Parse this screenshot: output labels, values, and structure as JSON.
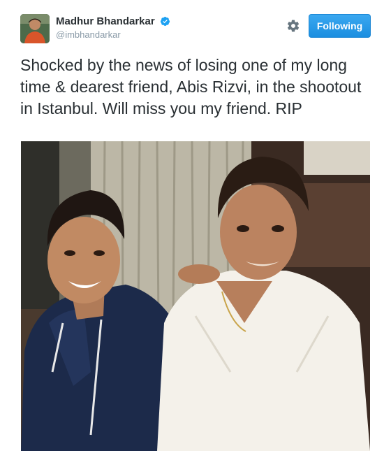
{
  "user": {
    "display_name": "Madhur Bhandarkar",
    "handle": "@imbhandarkar",
    "verified_icon": "verified-badge-icon"
  },
  "actions": {
    "settings_icon": "gear-icon",
    "follow_label": "Following"
  },
  "tweet": {
    "text": "Shocked by the news of losing one of my long time & dearest friend, Abis Rizvi, in the shootout in Istanbul. Will miss you my friend. RIP"
  },
  "colors": {
    "follow_button": "#1da1f2",
    "handle": "#8899a6",
    "text": "#292f33",
    "verified": "#1da1f2"
  }
}
